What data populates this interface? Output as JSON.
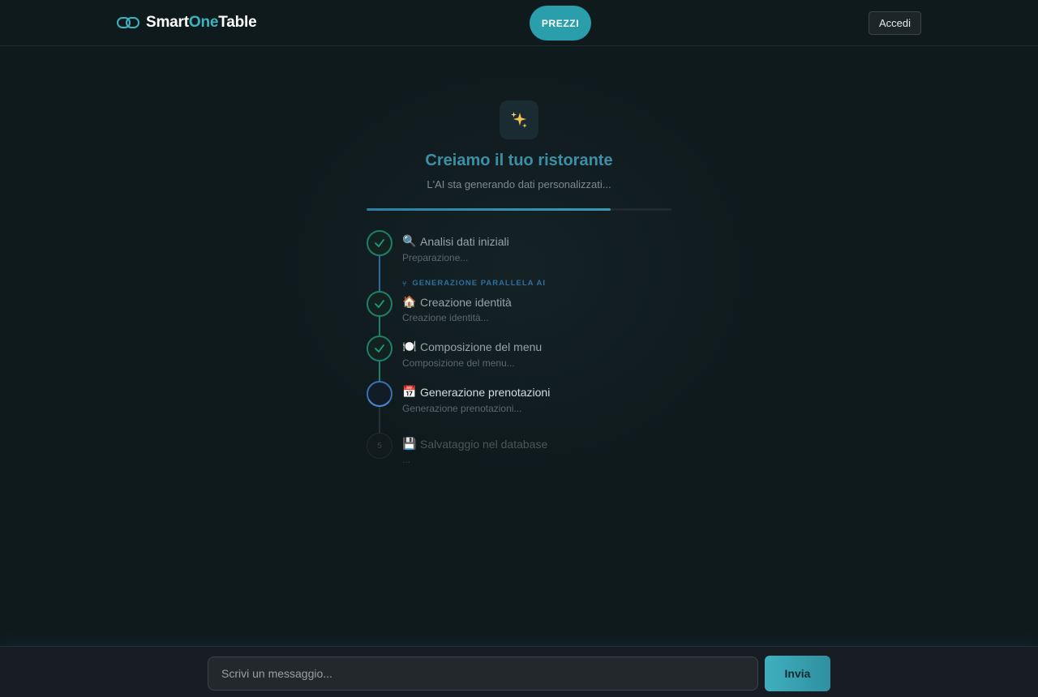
{
  "header": {
    "brand_part1": "Smart",
    "brand_part2": "One",
    "brand_part3": "Table",
    "pricing_label": "PREZZI",
    "login_label": "Accedi"
  },
  "generation": {
    "icon": "sparkles-icon",
    "title": "Creiamo il tuo ristorante",
    "subtitle": "L'AI sta generando dati personalizzati...",
    "progress_fraction": 0.8,
    "parallel_label": "GENERAZIONE PARALLELA AI",
    "steps": [
      {
        "emoji": "🔍",
        "title": "Analisi dati iniziali",
        "subtitle": "Preparazione...",
        "status": "done"
      },
      {
        "emoji": "🏠",
        "title": "Creazione identità",
        "subtitle": "Creazione identità...",
        "status": "done"
      },
      {
        "emoji": "🍽️",
        "title": "Composizione del menu",
        "subtitle": "Composizione del menu...",
        "status": "done"
      },
      {
        "emoji": "📅",
        "title": "Generazione prenotazioni",
        "subtitle": "Generazione prenotazioni...",
        "status": "active"
      },
      {
        "emoji": "💾",
        "title": "Salvataggio nel database",
        "subtitle": "...",
        "status": "pending",
        "number": "5"
      }
    ]
  },
  "chat": {
    "placeholder": "Scrivi un messaggio...",
    "send_label": "Invia"
  },
  "colors": {
    "accent": "#3fb2c0",
    "done": "#1f7f6a",
    "active": "#3a6fb5",
    "title": "#3d8fa6"
  }
}
